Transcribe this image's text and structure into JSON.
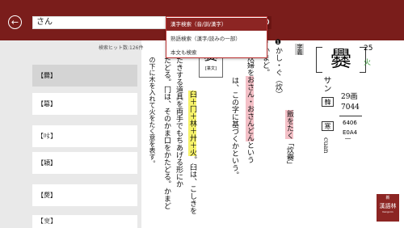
{
  "search": {
    "value": "さん"
  },
  "dropdown": {
    "items": [
      "漢字検索（音/訓/漢字）",
      "熟語検索（漢字/読みの一部）",
      "本文も検索"
    ]
  },
  "results": {
    "count_text": "検索ヒット数:126件",
    "items": [
      "【爨】",
      "【簒】",
      "【𠮼】",
      "【㯋】",
      "【㷗】",
      "【𢾶】"
    ]
  },
  "entry": {
    "kanji": "爨",
    "reading": "サン",
    "ref_boxes": [
      "韓",
      "寒"
    ],
    "pinyin": "cuan",
    "strokes": "29画",
    "jis": "7044",
    "unicode": "6406",
    "jis_code": "E0A4",
    "dash": "―",
    "grade": "25",
    "element": "火",
    "form_label": "[篆文]",
    "col_label": "字義",
    "col1_num": "❶",
    "col1_text": "かし・ぐ",
    "col1_paren": "（炊）",
    "col1_hl": "飯をたく",
    "col1_end": "「炊爨",
    "col1_close": "」",
    "col2_num": "❷",
    "col2_text": "かまど。",
    "col3_label": "国",
    "col3_text": "炊婦を",
    "col3_hl": "おさん・おさんどん",
    "col3_end": "という",
    "col4_text": "は、この字に基づくかという。",
    "col5_hl": "臼＋冂＋林＋廾＋火",
    "col5_text": "。臼は、こしきを",
    "col6_text": "たきする道具を両手でもちあげる形にか",
    "col7_text": "たどる。冂は、そのかま口をかたどる。かまど",
    "col8_text": "の下に木を入れて火をたく意を表す。"
  },
  "logo": {
    "small": "新",
    "main": "漢語林",
    "sub": "Kangorin"
  },
  "colors": {
    "topbar": "#7a1d1b",
    "accent": "#8c2523",
    "highlight": "#f6f26a",
    "pink": "#f4c0c7"
  }
}
